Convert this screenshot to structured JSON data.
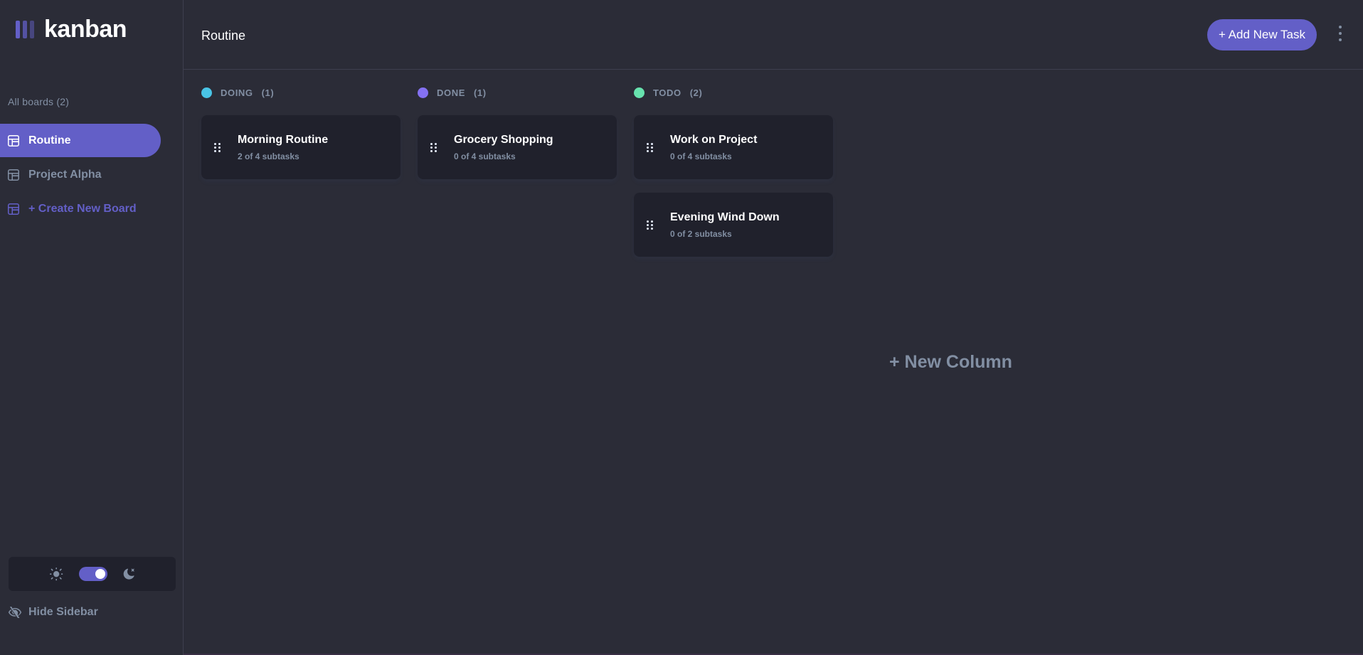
{
  "app": {
    "logo_text": "kanban"
  },
  "sidebar": {
    "all_boards_label": "All boards (2)",
    "boards": [
      {
        "label": "Routine",
        "active": true
      },
      {
        "label": "Project Alpha",
        "active": false
      }
    ],
    "create_board_label": "+ Create New Board",
    "theme": {
      "mode": "dark"
    },
    "hide_sidebar_label": "Hide Sidebar"
  },
  "header": {
    "board_title": "Routine",
    "add_task_label": "+ Add New Task"
  },
  "columns": [
    {
      "name": "DOING",
      "count": "(1)",
      "color": "#49c4e5",
      "cards": [
        {
          "title": "Morning Routine",
          "subtasks": "2 of 4 subtasks"
        }
      ]
    },
    {
      "name": "DONE",
      "count": "(1)",
      "color": "#8471f2",
      "cards": [
        {
          "title": "Grocery Shopping",
          "subtasks": "0 of 4 subtasks"
        }
      ]
    },
    {
      "name": "TODO",
      "count": "(2)",
      "color": "#67e2ae",
      "cards": [
        {
          "title": "Work on Project",
          "subtasks": "0 of 4 subtasks"
        },
        {
          "title": "Evening Wind Down",
          "subtasks": "0 of 2 subtasks"
        }
      ]
    }
  ],
  "new_column_label": "+ New Column",
  "colors": {
    "accent": "#635fc7",
    "background": "#2b2c37",
    "card": "#20212c",
    "muted": "#828fa3"
  }
}
